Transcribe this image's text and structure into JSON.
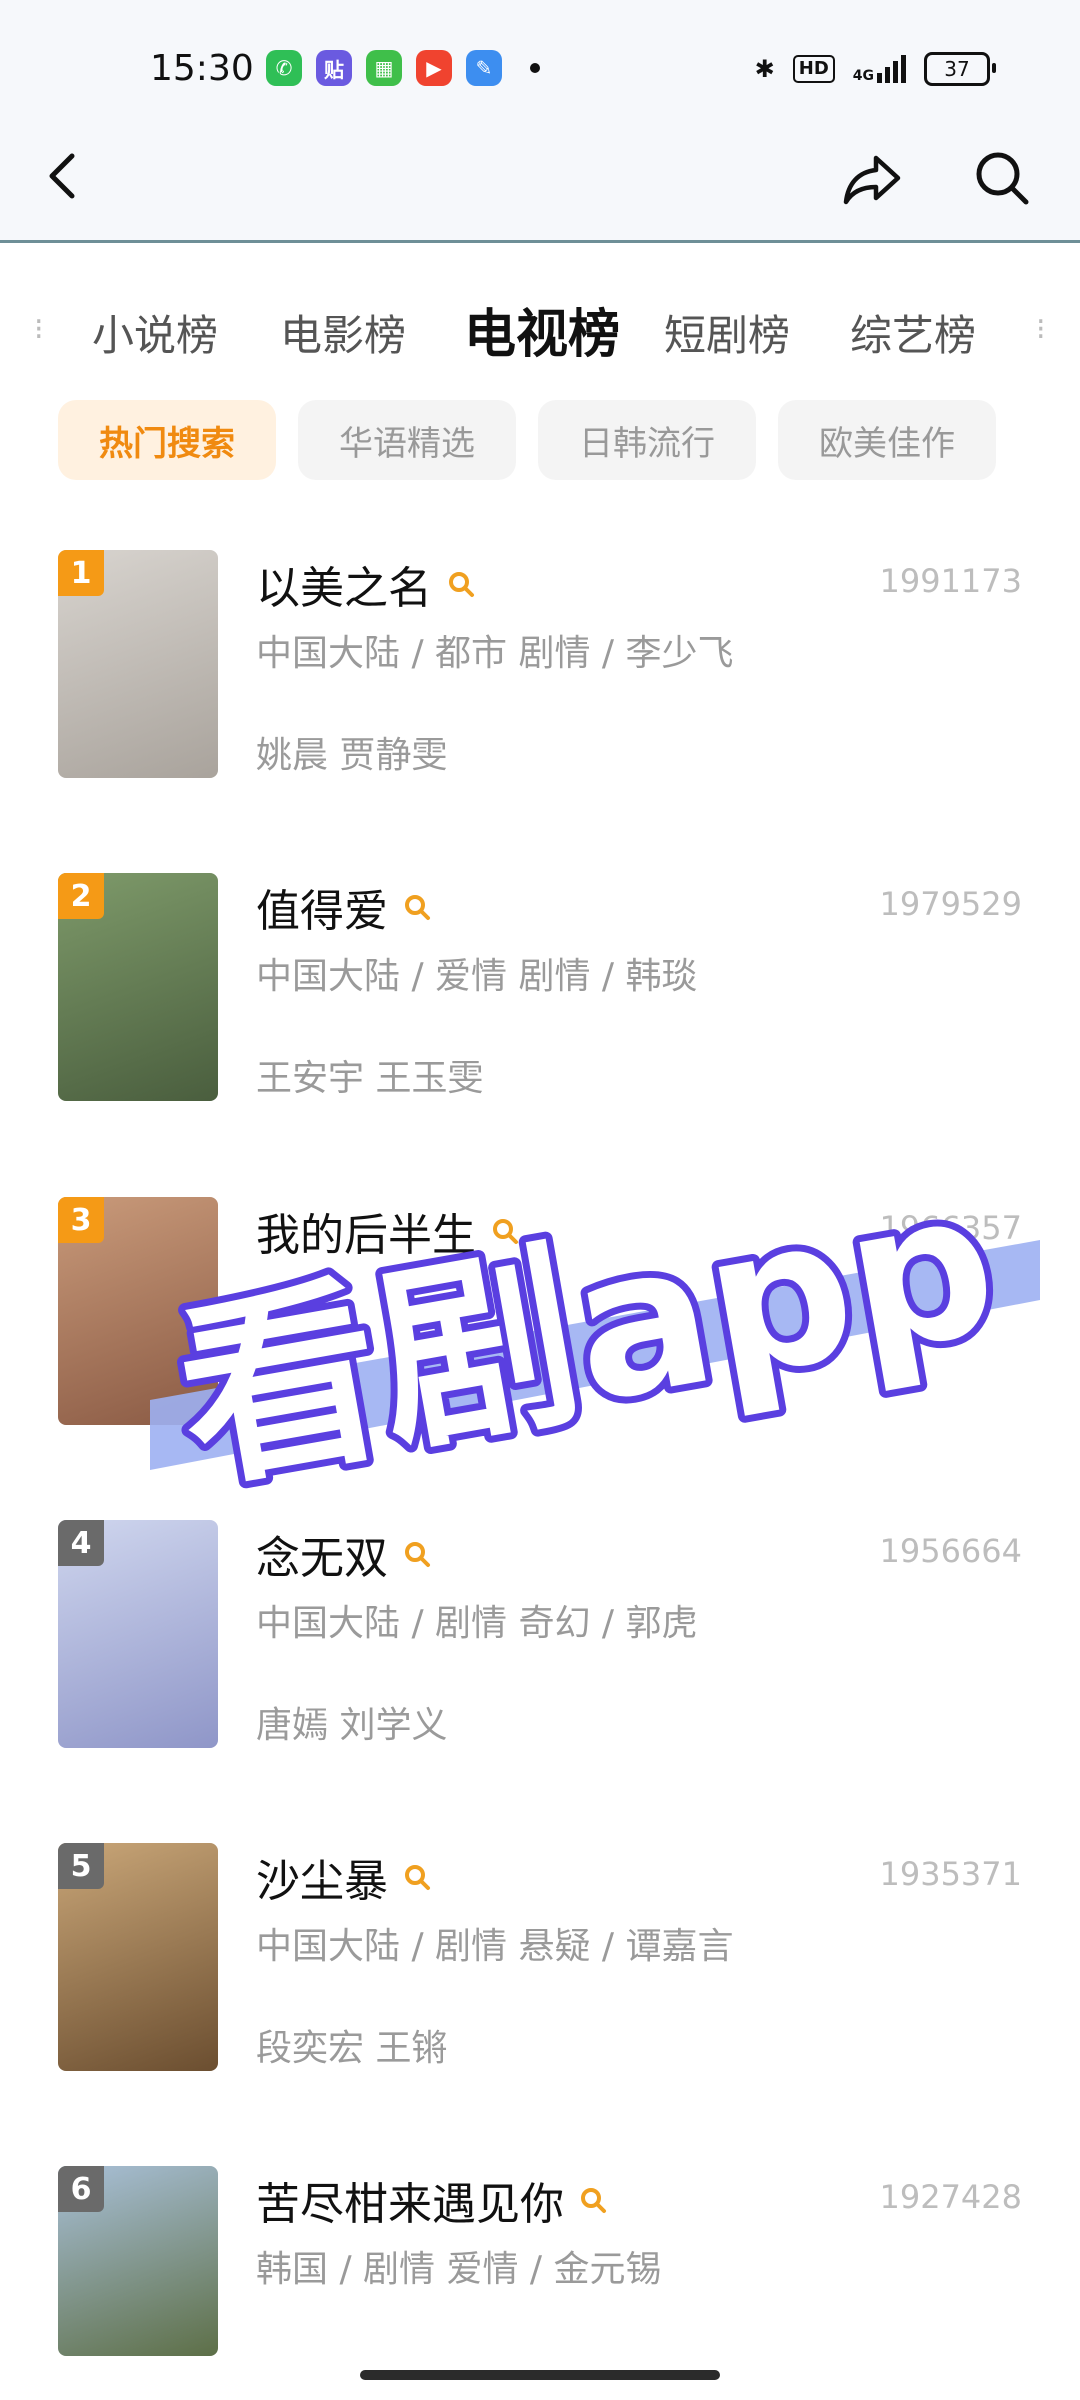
{
  "status_bar": {
    "time": "15:30",
    "notification_icons": [
      {
        "icon": "phone-icon",
        "color": "#2fbf56",
        "glyph": "✆"
      },
      {
        "icon": "tieba-icon",
        "color": "#6a5ae0",
        "glyph": "贴"
      },
      {
        "icon": "calendar-app-icon",
        "color": "#3fbf4a",
        "glyph": "▦"
      },
      {
        "icon": "video-app-icon",
        "color": "#f0432f",
        "glyph": "▶"
      },
      {
        "icon": "feather-app-icon",
        "color": "#3d8ef0",
        "glyph": "✎"
      }
    ],
    "hd_label": "HD",
    "network_label": "4G",
    "battery_level": "37"
  },
  "nav": {
    "back_icon": "back-arrow-icon",
    "share_icon": "share-icon",
    "search_icon": "search-icon"
  },
  "category_tabs": [
    {
      "label": "小说榜",
      "active": false
    },
    {
      "label": "电影榜",
      "active": false
    },
    {
      "label": "电视榜",
      "active": true
    },
    {
      "label": "短剧榜",
      "active": false
    },
    {
      "label": "综艺榜",
      "active": false
    }
  ],
  "sub_tabs": [
    {
      "label": "热门搜索",
      "active": true
    },
    {
      "label": "华语精选",
      "active": false
    },
    {
      "label": "日韩流行",
      "active": false
    },
    {
      "label": "欧美佳作",
      "active": false
    }
  ],
  "items": [
    {
      "rank": "1",
      "title": "以美之名",
      "score": "1991173",
      "meta": "中国大陆 / 都市 剧情 / 李少飞",
      "cast": "姚晨 贾静雯",
      "poster_colors": [
        "#d8d4cf",
        "#a9a39c"
      ]
    },
    {
      "rank": "2",
      "title": "值得爱",
      "score": "1979529",
      "meta": "中国大陆 / 爱情 剧情 / 韩琰",
      "cast": "王安宇 王玉雯",
      "poster_colors": [
        "#7e9a6a",
        "#4a5e3e"
      ]
    },
    {
      "rank": "3",
      "title": "我的后半生",
      "score": "1966357",
      "meta": "",
      "cast": "",
      "poster_colors": [
        "#c99a7a",
        "#8a5a44"
      ]
    },
    {
      "rank": "4",
      "title": "念无双",
      "score": "1956664",
      "meta": "中国大陆 / 剧情 奇幻 / 郭虎",
      "cast": "唐嫣 刘学义",
      "poster_colors": [
        "#cfd6ee",
        "#8f96c8"
      ]
    },
    {
      "rank": "5",
      "title": "沙尘暴",
      "score": "1935371",
      "meta": "中国大陆 / 剧情 悬疑 / 谭嘉言",
      "cast": "段奕宏 王锵",
      "poster_colors": [
        "#c9a678",
        "#6b4e30"
      ]
    },
    {
      "rank": "6",
      "title": "苦尽柑来遇见你",
      "score": "1927428",
      "meta": "韩国 / 剧情 爱情 / 金元锡",
      "cast": "",
      "poster_colors": [
        "#a9c0d8",
        "#5d6f47"
      ]
    }
  ],
  "watermark": {
    "text": "看剧app",
    "fill": "#ffffff",
    "stroke": "#5a3fe0",
    "band_color": "#9db0f2"
  }
}
